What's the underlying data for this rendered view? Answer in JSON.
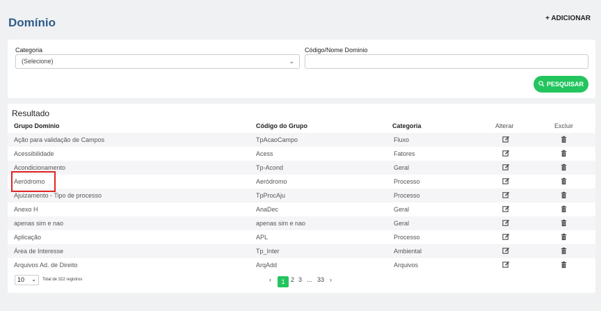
{
  "header": {
    "title": "Domínio",
    "add_label": "+ ADICIONAR"
  },
  "filters": {
    "categoria_label": "Categoria",
    "categoria_value": "(Selecione)",
    "codigo_label": "Código/Nome Dominio",
    "codigo_value": "",
    "search_label": "PESQUISAR"
  },
  "results": {
    "title": "Resultado",
    "columns": {
      "grupo": "Grupo Domínio",
      "codigo": "Código do Grupo",
      "categoria": "Categoria",
      "alterar": "Alterar",
      "excluir": "Excluir"
    },
    "rows": [
      {
        "grupo": "Ação para validação de Campos",
        "codigo": "TpAcaoCampo",
        "categoria": "Fluxo"
      },
      {
        "grupo": "Acessibilidade",
        "codigo": "Acess",
        "categoria": "Fatores"
      },
      {
        "grupo": "Acondicionamento",
        "codigo": "Tp-Acond",
        "categoria": "Geral"
      },
      {
        "grupo": "Aeródromo",
        "codigo": "Aeródromo",
        "categoria": "Processo"
      },
      {
        "grupo": "Ajuizamento - Tipo de processo",
        "codigo": "TpProcAju",
        "categoria": "Processo"
      },
      {
        "grupo": "Anexo H",
        "codigo": "AnaDec",
        "categoria": "Geral"
      },
      {
        "grupo": "apenas sim e nao",
        "codigo": "apenas sim e nao",
        "categoria": "Geral"
      },
      {
        "grupo": "Aplicação",
        "codigo": "APL",
        "categoria": "Processo"
      },
      {
        "grupo": "Área de Interesse",
        "codigo": "Tp_Inter",
        "categoria": "Ambiental"
      },
      {
        "grupo": "Arquivos Ad. de Direito",
        "codigo": "ArqAdd",
        "categoria": "Arquivos"
      }
    ]
  },
  "footer": {
    "page_size": "10",
    "total_text": "Total de 322 registros",
    "prev": "‹",
    "pages": [
      "1",
      "2",
      "3"
    ],
    "ellipsis": "...",
    "last_page": "33",
    "next": "›"
  },
  "colors": {
    "accent": "#22c55e",
    "title": "#2e5d8a",
    "highlight": "#e02424"
  }
}
